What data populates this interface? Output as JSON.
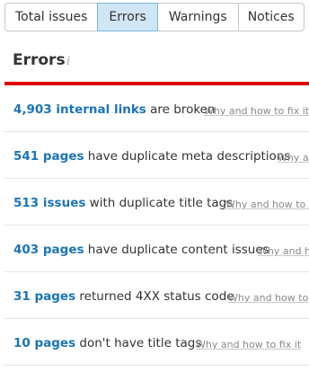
{
  "tabs": [
    {
      "label": "Total issues",
      "active": false
    },
    {
      "label": "Errors",
      "active": true
    },
    {
      "label": "Warnings",
      "active": false
    },
    {
      "label": "Notices",
      "active": false
    }
  ],
  "section": {
    "title": "Errors",
    "info_icon": "i"
  },
  "colors": {
    "accent_bar": "#e00000",
    "link": "#1a74b8",
    "active_tab": "#cfe6f6"
  },
  "issues": [
    {
      "link": "4,903 internal links",
      "text": " are broken",
      "fix": "Why and how to fix it"
    },
    {
      "link": "541 pages",
      "text": " have duplicate meta descriptions",
      "fix": "Why and how to fix it"
    },
    {
      "link": "513 issues",
      "text": " with duplicate title tags",
      "fix": "Why and how to fix it"
    },
    {
      "link": "403 pages",
      "text": " have duplicate content issues",
      "fix": "Why and how to fix it"
    },
    {
      "link": "31 pages",
      "text": " returned 4XX status code",
      "fix": "Why and how to fix it"
    },
    {
      "link": "10 pages",
      "text": " don't have title tags",
      "fix": "Why and how to fix it"
    }
  ]
}
